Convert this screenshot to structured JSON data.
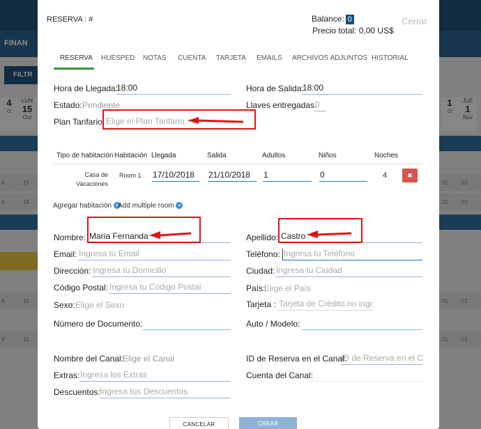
{
  "background": {
    "nav_label": "FINAN",
    "filter_label": "FILTR",
    "dates_left": [
      {
        "day": "",
        "num": "4",
        "mon": "ct"
      },
      {
        "day": "LUN",
        "num": "15",
        "mon": "Oct"
      }
    ],
    "dates_right": [
      {
        "day": "",
        "num": "1",
        "mon": "ct"
      },
      {
        "day": "JUE",
        "num": "1",
        "mon": "Nov"
      }
    ],
    "row_left": [
      "4",
      "15"
    ],
    "row_right": [
      "01",
      "01",
      "01"
    ]
  },
  "modal": {
    "title": "RESERVA : #",
    "balance_label": "Balance:",
    "balance_value": "0",
    "total_label": "Precio total:",
    "total_value": "0,00 US$",
    "close_label": "Cerrar"
  },
  "tabs": [
    "RESERVA",
    "HUÉSPED",
    "NOTAS",
    "CUENTA",
    "TARJETA",
    "EMAILS",
    "ARCHIVOS ADJUNTOS",
    "HISTORIAL"
  ],
  "form": {
    "arrival_label": "Hora de Llegada:",
    "arrival_value": "18:00",
    "departure_label": "Hora de Salida:",
    "departure_value": "18:00",
    "status_label": "Estado:",
    "status_value": "Pendiente",
    "keys_label": "Llaves entregadas:",
    "keys_value": "0",
    "rate_plan_label": "Plan Tarifario:",
    "rate_plan_placeholder": "Elige el Plan Tarifario"
  },
  "rooms_table": {
    "headers": [
      "Tipo de habitación",
      "Habitación",
      "Llegada",
      "Salida",
      "Adultos",
      "Niños",
      "Noches"
    ],
    "rows": [
      {
        "type_line1": "Casa de",
        "type_line2": "Vacaciones",
        "room": "Room 1",
        "arrival": "17/10/2018",
        "departure": "21/10/2018",
        "adults": "1",
        "children": "0",
        "nights": "4"
      }
    ],
    "delete_icon": "✖"
  },
  "links": {
    "add_room": "Agregar habitación",
    "add_multiple": "Add multiple room"
  },
  "guest": {
    "name_label": "Nombre:",
    "name_value": "Maria Fernanda",
    "surname_label": "Apellido:",
    "surname_value": "Castro",
    "email_label": "Email:",
    "email_placeholder": "Ingresa tu Email",
    "phone_label": "Teléfono:",
    "phone_placeholder": "Ingresa tu Teléfono",
    "address_label": "Dirección:",
    "address_placeholder": "Ingresa tu Domicilio",
    "city_label": "Ciudad:",
    "city_placeholder": "Ingresa tu Ciudad",
    "zip_label": "Código Postal:",
    "zip_placeholder": "Ingresa tu Código Postal",
    "country_label": "País:",
    "country_placeholder": "Elige el País",
    "sex_label": "Sexo:",
    "sex_placeholder": "Elige el Sexo",
    "card_label": "Tarjeta :",
    "card_placeholder": "Tarjeta de Crédito no ingr",
    "doc_label": "Número de Documento:",
    "car_label": "Auto / Modelo:"
  },
  "channel": {
    "channel_name_label": "Nombre del Canal:",
    "channel_name_placeholder": "Elige el Canal",
    "channel_id_label": "ID de Reserva en el Canal:",
    "channel_id_placeholder": "ID de Reserva en el Ca",
    "extras_label": "Extras:",
    "extras_placeholder": "Ingresa los Extras",
    "channel_account_label": "Cuenta del Canal:",
    "discounts_label": "Descuentos:",
    "discounts_placeholder": "Ingresa tus Descuentos"
  },
  "buttons": {
    "cancel": "CANCELAR",
    "create": "CREAR"
  },
  "annotation_color": "#e01414"
}
